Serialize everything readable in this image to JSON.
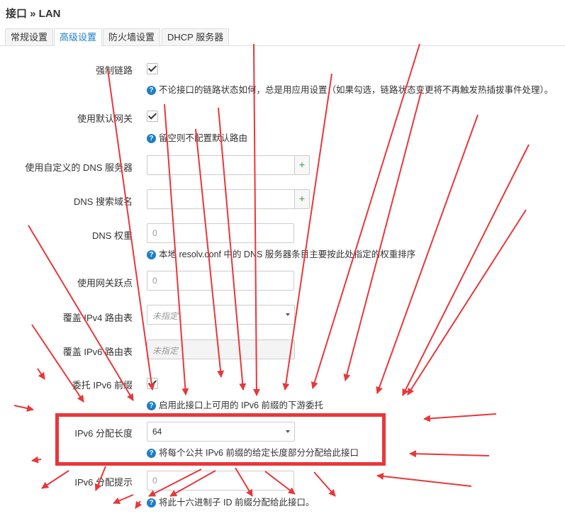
{
  "page": {
    "title": "接口 » LAN"
  },
  "tabs": [
    {
      "label": "常规设置"
    },
    {
      "label": "高级设置"
    },
    {
      "label": "防火墙设置"
    },
    {
      "label": "DHCP 服务器"
    }
  ],
  "fields": {
    "force_link": {
      "label": "强制链路",
      "checked": true,
      "help": "不论接口的链路状态如何，总是用应用设置（如果勾选，链路状态变更将不再触发热插拔事件处理）。"
    },
    "default_gateway": {
      "label": "使用默认网关",
      "checked": true,
      "help": "留空则不配置默认路由"
    },
    "custom_dns": {
      "label": "使用自定义的 DNS 服务器",
      "value": "",
      "add_label": "+"
    },
    "dns_search": {
      "label": "DNS 搜索域名",
      "value": "",
      "add_label": "+"
    },
    "dns_weight": {
      "label": "DNS 权重",
      "placeholder": "0",
      "help": "本地 resolv.conf 中的 DNS 服务器条目主要按此处指定的权重排序"
    },
    "gateway_metric": {
      "label": "使用网关跃点",
      "placeholder": "0"
    },
    "ipv4_route_table": {
      "label": "覆盖 IPv4 路由表",
      "value": "未指定"
    },
    "ipv6_route_table": {
      "label": "覆盖 IPv6 路由表",
      "value": "未指定"
    },
    "delegate_prefix": {
      "label": "委托 IPv6 前缀",
      "checked": true,
      "help": "启用此接口上可用的 IPv6 前缀的下游委托"
    },
    "ipv6_assign_length": {
      "label": "IPv6 分配长度",
      "value": "64",
      "help": "将每个公共 IPv6 前缀的给定长度部分分配给此接口"
    },
    "ipv6_assign_hint": {
      "label": "IPv6 分配提示",
      "placeholder": "0",
      "help": "将此十六进制子 ID 前缀分配给此接口。"
    }
  },
  "colors": {
    "accent": "#1d7fc6",
    "annotation": "#e8373a"
  },
  "icons": {
    "help": "question-circle-icon",
    "add": "plus-icon",
    "check": "check-icon",
    "dropdown": "chevron-down-icon"
  }
}
